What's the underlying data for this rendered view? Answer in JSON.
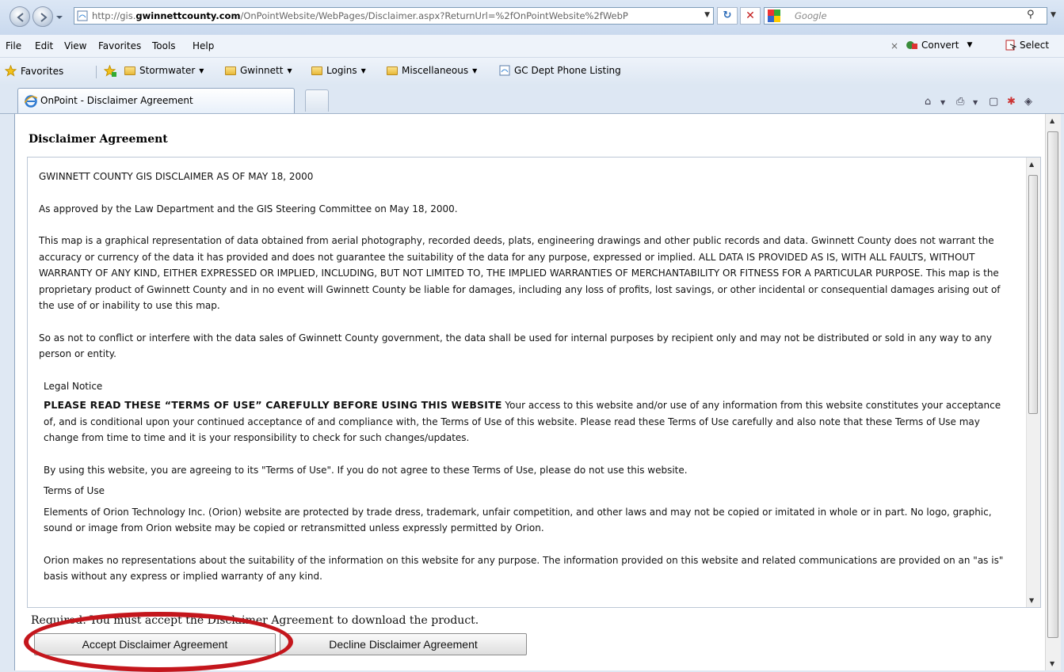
{
  "browser": {
    "url_prefix": "http://gis.",
    "url_domain": "gwinnettcounty.com",
    "url_rest": "/OnPointWebsite/WebPages/Disclaimer.aspx?ReturnUrl=%2fOnPointWebsite%2fWebP",
    "search_placeholder": "Google",
    "menu": [
      "File",
      "Edit",
      "View",
      "Favorites",
      "Tools",
      "Help"
    ],
    "toolbar_right": {
      "close": "×",
      "convert": "Convert",
      "select": "Select"
    },
    "favorites": {
      "label": "Favorites",
      "items": [
        "Stormwater",
        "Gwinnett",
        "Logins",
        "Miscellaneous",
        "GC Dept Phone Listing"
      ]
    },
    "tab": {
      "title": "OnPoint - Disclaimer Agreement"
    }
  },
  "page": {
    "title": "Disclaimer Agreement",
    "paragraphs": {
      "p1": "GWINNETT COUNTY GIS DISCLAIMER AS OF MAY 18, 2000",
      "p2": "As approved by the Law Department and the GIS Steering Committee on May 18, 2000.",
      "p3": "This map is a graphical representation of data obtained from aerial photography, recorded deeds, plats, engineering drawings and other public records and data. Gwinnett County does not warrant the accuracy or currency of the data it has provided and does not guarantee the suitability of the data for any purpose, expressed or implied. ALL DATA IS PROVIDED AS IS, WITH ALL FAULTS, WITHOUT WARRANTY OF ANY KIND, EITHER EXPRESSED OR IMPLIED, INCLUDING, BUT NOT LIMITED TO, THE IMPLIED WARRANTIES OF MERCHANTABILITY OR FITNESS FOR A PARTICULAR PURPOSE. This map is the proprietary product of Gwinnett County and in no event will Gwinnett County be liable for damages, including any loss of profits, lost savings, or other incidental or consequential damages arising out of the use of or inability to use this map.",
      "p4": "So as not to conflict or interfere with the data sales of Gwinnett County government, the data shall be used for internal purposes by recipient only and may not be distributed or sold in any way to any person or entity.",
      "legal_heading": "Legal Notice",
      "terms_lead": "PLEASE READ THESE “TERMS OF USE” CAREFULLY BEFORE USING THIS WEBSITE",
      "terms_body": " Your access to this website and/or use of any information from this website constitutes your acceptance of, and is conditional upon your continued acceptance of and compliance with, the Terms of Use of this website. Please read these Terms of Use carefully and also note that these Terms of Use may change from time to time and it is your responsibility to check for such changes/updates.",
      "agree": "By using this website, you are agreeing to its \"Terms of Use\". If you do not agree to these Terms of Use, please do not use this website.",
      "terms_heading": "Terms of Use",
      "orion1": "Elements of Orion Technology Inc. (Orion) website are protected by trade dress, trademark, unfair competition, and other laws and may not be copied or imitated in whole or in part. No logo, graphic, sound or image from Orion website may be copied or retransmitted unless expressly permitted by Orion.",
      "orion2": "Orion makes no representations about the suitability of the information on this website for any purpose. The information provided on this website and related communications are provided on an \"as is\" basis without any express or implied warranty of any kind."
    },
    "required_text": "Required: You must accept the Disclaimer Agreement to download the product.",
    "accept_button": "Accept Disclaimer Agreement",
    "decline_button": "Decline Disclaimer Agreement"
  },
  "colors": {
    "highlight": "#c4161c",
    "chrome": "#dde7f3"
  }
}
